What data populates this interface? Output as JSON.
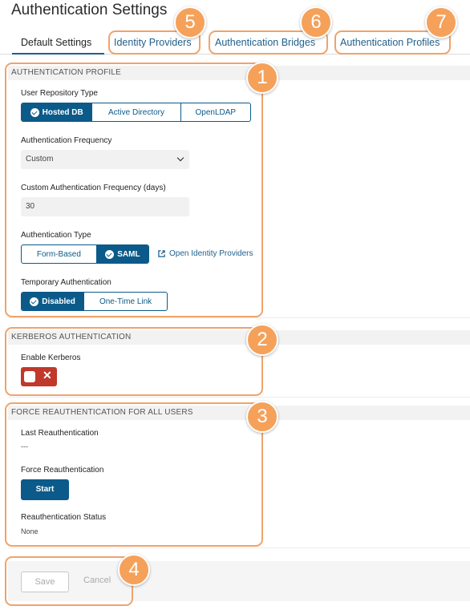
{
  "page": {
    "title": "Authentication Settings"
  },
  "tabs": [
    {
      "label": "Default Settings",
      "active": true
    },
    {
      "label": "Identity Providers"
    },
    {
      "label": "Authentication Bridges"
    },
    {
      "label": "Authentication Profiles"
    }
  ],
  "callouts": [
    "1",
    "2",
    "3",
    "4",
    "5",
    "6",
    "7"
  ],
  "auth_profile": {
    "header": "AUTHENTICATION PROFILE",
    "repo_type_label": "User Repository Type",
    "repo_options": [
      "Hosted DB",
      "Active Directory",
      "OpenLDAP"
    ],
    "frequency_label": "Authentication Frequency",
    "frequency_value": "Custom",
    "custom_freq_label": "Custom Authentication Frequency (days)",
    "custom_freq_value": "30",
    "auth_type_label": "Authentication Type",
    "auth_type_options": [
      "Form-Based",
      "SAML"
    ],
    "open_idp_link": "Open Identity Providers",
    "temp_auth_label": "Temporary Authentication",
    "temp_auth_options": [
      "Disabled",
      "One-Time Link"
    ]
  },
  "kerberos": {
    "header": "KERBEROS AUTHENTICATION",
    "enable_label": "Enable Kerberos",
    "toggle_symbol": "✕"
  },
  "force_reauth": {
    "header": "FORCE REAUTHENTICATION FOR ALL USERS",
    "last_label": "Last Reauthentication",
    "last_value": "---",
    "force_label": "Force Reauthentication",
    "start_button": "Start",
    "status_label": "Reauthentication Status",
    "status_value": "None"
  },
  "footer": {
    "save": "Save",
    "cancel": "Cancel"
  },
  "colors": {
    "primary": "#0b5a8a",
    "callout": "#f5a15a",
    "toggle_off": "#c0392b",
    "link": "#1f5f8b"
  }
}
